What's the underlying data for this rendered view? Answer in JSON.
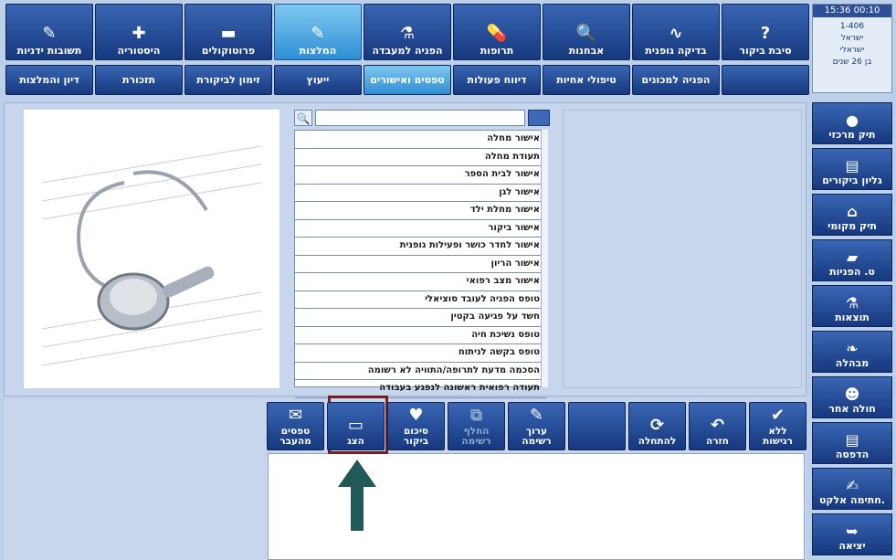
{
  "top_tabs": [
    {
      "label": "סיבת ביקור",
      "icon": "question-icon"
    },
    {
      "label": "בדיקה גופנית",
      "icon": "stethoscope-icon"
    },
    {
      "label": "אבחנות",
      "icon": "magnifier-icon"
    },
    {
      "label": "תרופות",
      "icon": "pills-icon"
    },
    {
      "label": "הפניה למעבדה",
      "icon": "flask-icon"
    },
    {
      "label": "המלצות",
      "icon": "syringe-icon"
    },
    {
      "label": "פרוטוקולים",
      "icon": "briefcase-icon"
    },
    {
      "label": "היסטוריה",
      "icon": "medkit-icon"
    },
    {
      "label": "תשובות ידניות",
      "icon": "note-icon"
    }
  ],
  "second_tabs": [
    "",
    "הפניה למכונים",
    "טיפולי אחיות",
    "דיווח פעולות",
    "טפסים ואישורים",
    "ייעוץ",
    "זימון לביקורת",
    "תזכורת",
    "דיון והמלצות"
  ],
  "patient": {
    "time": "15:36",
    "id_short": "00:10",
    "code": "1-406",
    "country": "ישראל",
    "nationality": "ישראלי",
    "age": "בן 26 שנים"
  },
  "forms_list": [
    "אישור מחלה",
    "תעודת מחלה",
    "אישור לבית הספר",
    "אישור לגן",
    "אישור מחלת ילד",
    "אישור ביקור",
    "אישור לחדר כושר ופעילות גופנית",
    "אישור הריון",
    "אישור מצב רפואי",
    "טופס הפניה לעובד סוציאלי",
    "חשד על פגיעה בקטין",
    "טופס נשיכת חיה",
    "טופס בקשה לניתוח",
    "הסכמה מדעת לתרופה/התוויה לא רשומה",
    "תעודה רפואית ראשונה לנפגע בעבודה"
  ],
  "actions": [
    {
      "label": "ללא רגישות",
      "icon": "check-icon"
    },
    {
      "label": "חזרה",
      "icon": "undo-arrow-icon"
    },
    {
      "label": "להתחלה",
      "icon": "refresh-icon"
    },
    {
      "label": "",
      "icon": ""
    },
    {
      "label": "ערוך רשימה",
      "icon": "pencil-icon"
    },
    {
      "label": "החלף רשימה",
      "icon": "swap-icon"
    },
    {
      "label": "סיכום ביקור",
      "icon": "summary-icon"
    },
    {
      "label": "הצג",
      "icon": "laptop-icon"
    },
    {
      "label": "טפסים מהעבר",
      "icon": "envelope-icon"
    }
  ],
  "sidebar": [
    {
      "label": "תיק מרכזי",
      "icon": "globe-icon"
    },
    {
      "label": "גליון ביקורים",
      "icon": "clipboard-icon"
    },
    {
      "label": "תיק מקומי",
      "icon": "house-icon"
    },
    {
      "label": "ט. הפניות",
      "icon": "folder-icon"
    },
    {
      "label": "תוצאות",
      "icon": "flask-icon"
    },
    {
      "label": "מבהלה",
      "icon": "feather-icon"
    },
    {
      "label": "חולה אחר",
      "icon": "person-icon"
    },
    {
      "label": "הדפסה",
      "icon": "printer-icon"
    },
    {
      "label": "חתימה אלקט.",
      "icon": "sign-icon"
    },
    {
      "label": "יציאה",
      "icon": "exit-arrow-icon"
    }
  ]
}
